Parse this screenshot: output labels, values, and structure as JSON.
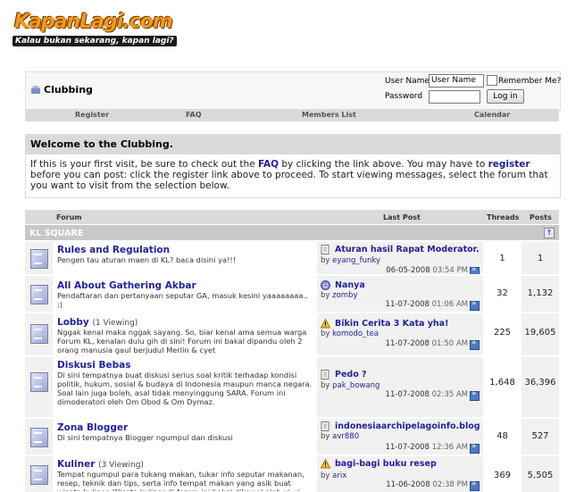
{
  "logo": {
    "title": "KapanLagi.com",
    "tagline": "Kalau bukan sekarang, kapan lagi?"
  },
  "breadcrumb": {
    "title": "Clubbing"
  },
  "login": {
    "username_label": "User Name",
    "username_value": "User Name",
    "password_label": "Password",
    "remember_label": "Remember Me?",
    "login_button": "Log in"
  },
  "navbar": {
    "register": "Register",
    "faq": "FAQ",
    "members": "Members List",
    "calendar": "Calendar"
  },
  "welcome": {
    "title": "Welcome to the Clubbing.",
    "text_1": "If this is your first visit, be sure to check out the ",
    "faq_link": "FAQ",
    "text_2": " by clicking the link above. You may have to ",
    "register_link": "register",
    "text_3": " before you can post: click the register link above to proceed. To start viewing messages, select the forum that you want to visit from the selection below."
  },
  "table": {
    "headers": {
      "forum": "Forum",
      "last_post": "Last Post",
      "threads": "Threads",
      "posts": "Posts"
    },
    "category": "KL SQUARE",
    "forums": [
      {
        "name": "Rules and Regulation",
        "viewing": "",
        "desc": "Pengen tau aturan maen di KL? baca disini ya!!!",
        "lp_title": "Aturan hasil Rapat Moderator...",
        "lp_by": "eyang_funky",
        "lp_date": "06-05-2008",
        "lp_time": "03:54 PM",
        "lp_icon": "post",
        "threads": "1",
        "posts": "1"
      },
      {
        "name": "All About Gathering Akbar",
        "viewing": "",
        "desc": "Pendaftaran dan pertanyaan seputar GA, masuk kesini yaaaaaaaa.. :)",
        "lp_title": "Nanya",
        "lp_by": "zomby",
        "lp_date": "11-07-2008",
        "lp_time": "01:06 AM",
        "lp_icon": "smile",
        "threads": "32",
        "posts": "1,132"
      },
      {
        "name": "Lobby",
        "viewing": "(1 Viewing)",
        "desc": "Nggak kenal maka nggak sayang. So, biar kenal ama semua warga Forum KL, kenalan dulu gih di sini! Forum ini bakal dipandu oleh 2 orang manusia gaul berjudul Merlin & cyet",
        "lp_title": "Bikin Cerita 3 Kata yha!",
        "lp_by": "komodo_tea",
        "lp_date": "11-07-2008",
        "lp_time": "01:50 AM",
        "lp_icon": "warning",
        "threads": "225",
        "posts": "19,605"
      },
      {
        "name": "Diskusi Bebas",
        "viewing": "",
        "desc": "Di sini tempatnya buat diskusi serius soal kritik terhadap kondisi politik, hukum, sosial & budaya di Indonesia maupun manca negara. Soal lain juga boleh, asal tidak menyinggung SARA. Forum ini dimoderatori oleh Om Obod & Om Dymaz.",
        "lp_title": "Pedo ?",
        "lp_by": "pak_bowang",
        "lp_date": "11-07-2008",
        "lp_time": "02:35 AM",
        "lp_icon": "post",
        "threads": "1,648",
        "posts": "36,396"
      },
      {
        "name": "Zona Blogger",
        "viewing": "",
        "desc": "Di sini tempatnya Blogger ngumpul dan diskusi",
        "lp_title": "indonesiaarchipelagoinfo.blogs...",
        "lp_by": "avr880",
        "lp_date": "11-07-2008",
        "lp_time": "12:36 AM",
        "lp_icon": "post",
        "threads": "48",
        "posts": "527"
      },
      {
        "name": "Kuliner",
        "viewing": "(3 Viewing)",
        "desc": "Tempat ngumpul para tukang makan, tukar info seputar makanan, resep, teknik dan tips, serta info tempat makan yang asik buat wisata kuliner. Wisata kuliner di forum ini bakal dikawal oleh yi_yi",
        "lp_title": "bagi-bagi buku resep",
        "lp_by": "arix",
        "lp_date": "11-06-2008",
        "lp_time": "02:38 PM",
        "lp_icon": "warning",
        "threads": "369",
        "posts": "5,505"
      }
    ]
  },
  "colors": {
    "link": "#22229c",
    "header_bg": "#dadada",
    "alt_bg": "#f1f1f1",
    "logo_orange": "#f39a1a"
  }
}
